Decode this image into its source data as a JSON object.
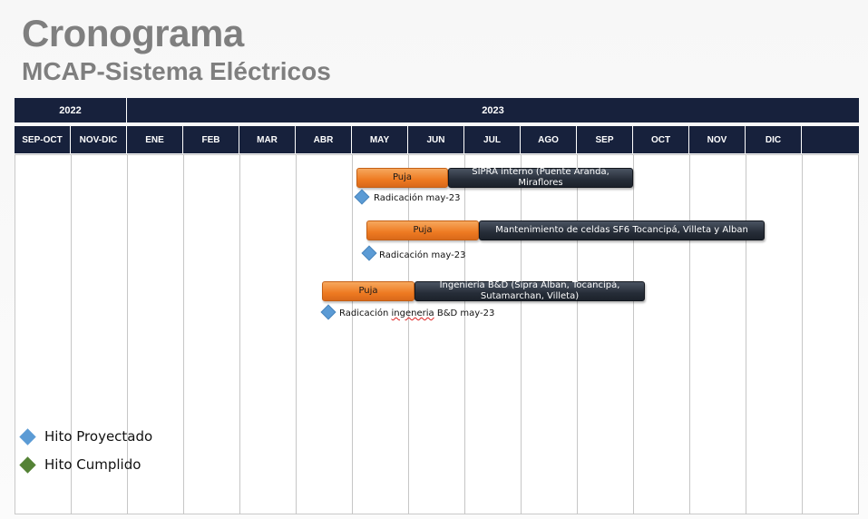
{
  "title": "Cronograma",
  "subtitle": "MCAP-Sistema Eléctricos",
  "years": [
    "2022",
    "2023"
  ],
  "months": [
    "SEP-OCT",
    "NOV-DIC",
    "ENE",
    "FEB",
    "MAR",
    "ABR",
    "MAY",
    "JUN",
    "JUL",
    "AGO",
    "SEP",
    "OCT",
    "NOV",
    "DIC"
  ],
  "tasks": [
    {
      "puja_label": "Puja",
      "puja_start": "MAY",
      "puja_end": "mid-JUN",
      "task_label_line1": "SIPRA interno (Puente Aranda,",
      "task_label_line2": "Miraflores",
      "task_start": "mid-JUN",
      "task_end": "mid-OCT",
      "milestone_label": "Radicación  may-23"
    },
    {
      "puja_label": "Puja",
      "puja_start": "MAY",
      "puja_end": "JUL",
      "task_label_line1": "Mantenimiento de celdas SF6 Tocancipá, Villeta y Alban",
      "task_label_line2": "",
      "task_start": "JUL",
      "task_end": "NOV",
      "milestone_label": "Radicación  may-23"
    },
    {
      "puja_label": "Puja",
      "puja_start": "ABR",
      "puja_end": "JUN",
      "task_label_line1": "Ingeniería B&D (Sipra Alban, Tocancipá,",
      "task_label_line2": "Sutamarchan, Villeta)",
      "task_start": "JUN",
      "task_end": "OCT",
      "milestone_label_a": "Radicación ",
      "milestone_label_b": "ingeneria",
      "milestone_label_c": " B&D  may-23"
    }
  ],
  "legend": [
    {
      "label": "Hito Proyectado",
      "color": "#5b9bd5"
    },
    {
      "label": "Hito Cumplido",
      "color": "#548235"
    }
  ],
  "colors": {
    "header_bg": "#17213c",
    "puja_bar": "#ee7a22",
    "task_bar": "#262d38",
    "milestone_projected": "#5b9bd5",
    "milestone_done": "#548235"
  }
}
